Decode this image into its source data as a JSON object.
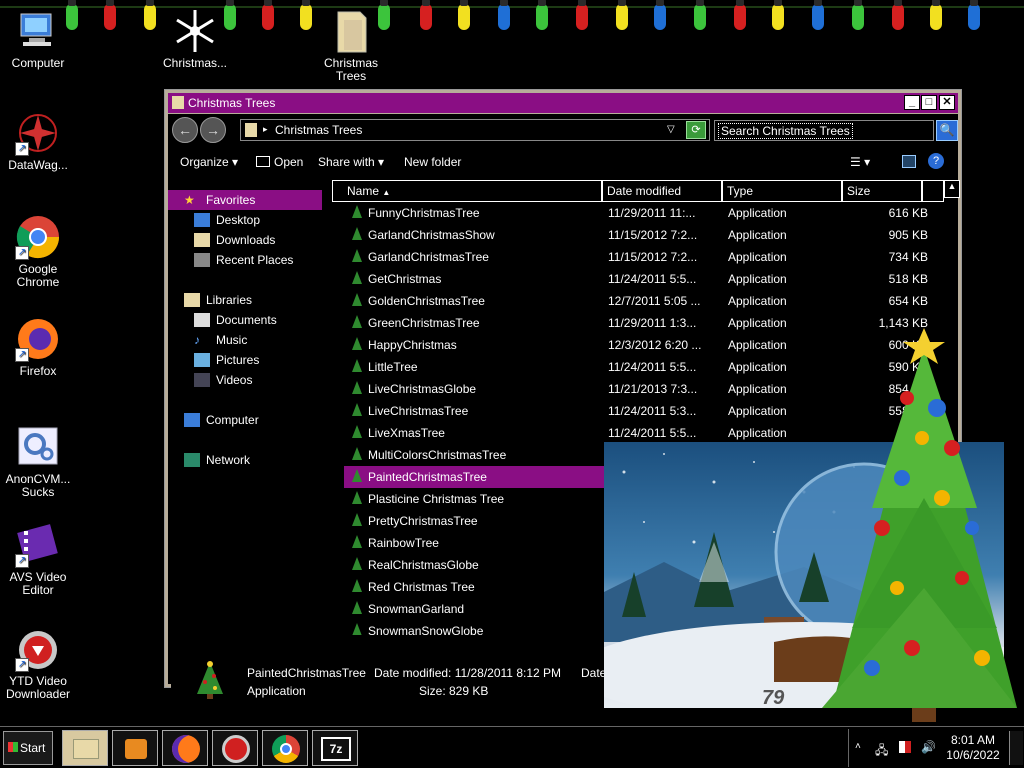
{
  "desktop": {
    "icons": [
      {
        "label": "Computer"
      },
      {
        "label": "Christmas..."
      },
      {
        "label": "Christmas Trees"
      },
      {
        "label": "DataWag..."
      },
      {
        "label": "Google Chrome"
      },
      {
        "label": "Firefox"
      },
      {
        "label": "AnonCVM... Sucks"
      },
      {
        "label": "AVS Video Editor"
      },
      {
        "label": "YTD Video Downloader"
      }
    ]
  },
  "window": {
    "title": "Christmas Trees",
    "address": "Christmas Trees",
    "search_placeholder": "Search Christmas Trees",
    "toolbar": {
      "organize": "Organize",
      "open": "Open",
      "share_with": "Share with",
      "new_folder": "New folder"
    },
    "nav": {
      "favorites": "Favorites",
      "desktop": "Desktop",
      "downloads": "Downloads",
      "recent_places": "Recent Places",
      "libraries": "Libraries",
      "documents": "Documents",
      "music": "Music",
      "pictures": "Pictures",
      "videos": "Videos",
      "computer": "Computer",
      "network": "Network"
    },
    "columns": {
      "name": "Name",
      "date": "Date modified",
      "type": "Type",
      "size": "Size"
    },
    "files": [
      {
        "name": "FunnyChristmasTree",
        "date": "11/29/2011 11:...",
        "type": "Application",
        "size": "616 KB"
      },
      {
        "name": "GarlandChristmasShow",
        "date": "11/15/2012 7:2...",
        "type": "Application",
        "size": "905 KB"
      },
      {
        "name": "GarlandChristmasTree",
        "date": "11/15/2012 7:2...",
        "type": "Application",
        "size": "734 KB"
      },
      {
        "name": "GetChristmas",
        "date": "11/24/2011 5:5...",
        "type": "Application",
        "size": "518 KB"
      },
      {
        "name": "GoldenChristmasTree",
        "date": "12/7/2011 5:05 ...",
        "type": "Application",
        "size": "654 KB"
      },
      {
        "name": "GreenChristmasTree",
        "date": "11/29/2011 1:3...",
        "type": "Application",
        "size": "1,143 KB"
      },
      {
        "name": "HappyChristmas",
        "date": "12/3/2012 6:20 ...",
        "type": "Application",
        "size": "600 KB"
      },
      {
        "name": "LittleTree",
        "date": "11/24/2011 5:5...",
        "type": "Application",
        "size": "590 KB"
      },
      {
        "name": "LiveChristmasGlobe",
        "date": "11/21/2013 7:3...",
        "type": "Application",
        "size": "854 KB"
      },
      {
        "name": "LiveChristmasTree",
        "date": "11/24/2011 5:3...",
        "type": "Application",
        "size": "558 KB"
      },
      {
        "name": "LiveXmasTree",
        "date": "11/24/2011 5:5...",
        "type": "Application",
        "size": "4..."
      },
      {
        "name": "MultiColorsChristmasTree",
        "date": "",
        "type": "",
        "size": ""
      },
      {
        "name": "PaintedChristmasTree",
        "date": "",
        "type": "",
        "size": ""
      },
      {
        "name": "Plasticine Christmas Tree",
        "date": "",
        "type": "",
        "size": ""
      },
      {
        "name": "PrettyChristmasTree",
        "date": "",
        "type": "",
        "size": ""
      },
      {
        "name": "RainbowTree",
        "date": "",
        "type": "",
        "size": ""
      },
      {
        "name": "RealChristmasGlobe",
        "date": "",
        "type": "",
        "size": ""
      },
      {
        "name": "Red Christmas Tree",
        "date": "",
        "type": "",
        "size": ""
      },
      {
        "name": "SnowmanGarland",
        "date": "",
        "type": "",
        "size": ""
      },
      {
        "name": "SnowmanSnowGlobe",
        "date": "",
        "type": "",
        "size": ""
      }
    ],
    "selected_index": 12,
    "details": {
      "name": "PaintedChristmasTree",
      "date_label": "Date modified: 11/28/2011 8:12 PM",
      "type": "Application",
      "size_label": "Size: 829 KB",
      "extra": "Date"
    }
  },
  "overlay": {
    "counter_text": "79"
  },
  "taskbar": {
    "start_label": "Start",
    "apps": [
      "file-explorer",
      "media-player",
      "firefox",
      "ytd-downloader",
      "chrome",
      "7zip"
    ],
    "app_7z_label": "7z",
    "time": "8:01 AM",
    "date": "10/6/2022"
  },
  "colors": {
    "accent": "#8a0e84",
    "window_frame": "#b8ad9a",
    "background": "#000000"
  }
}
